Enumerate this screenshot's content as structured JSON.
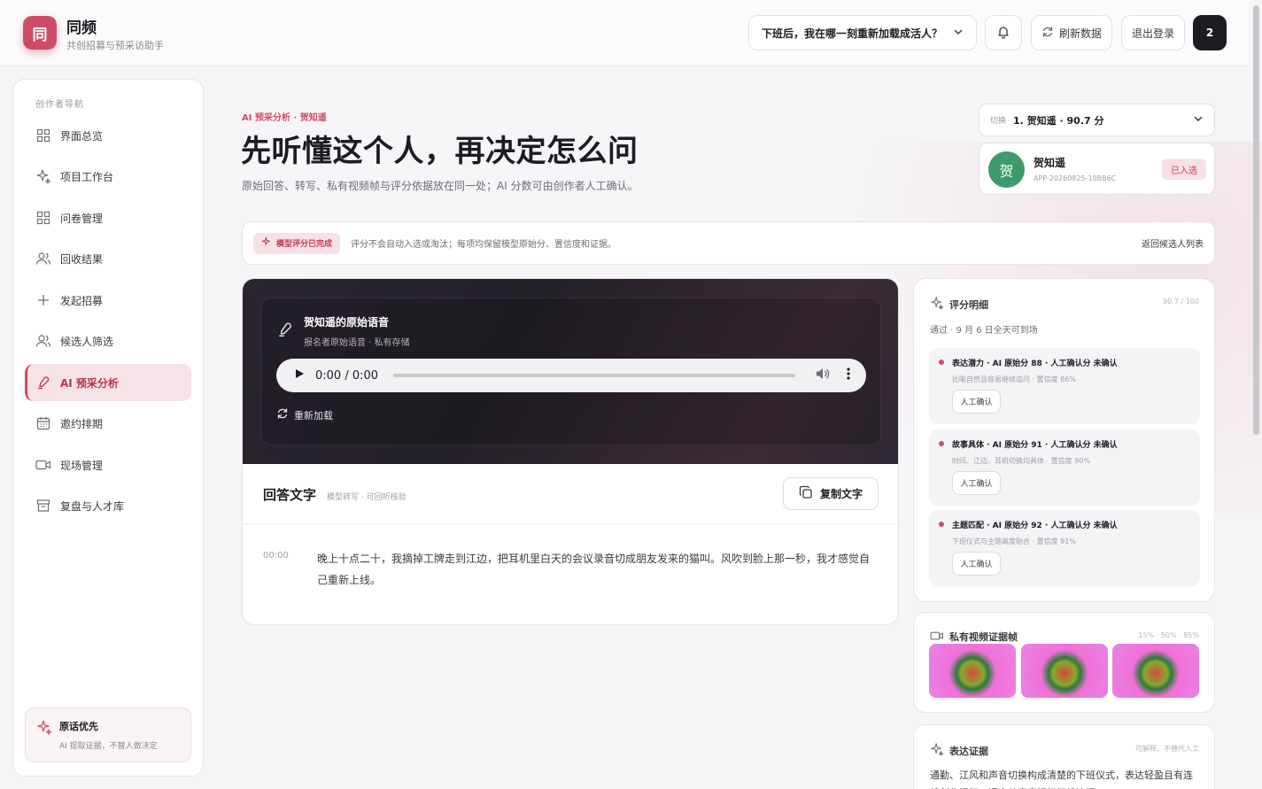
{
  "header": {
    "logo_char": "同",
    "brand": "同频",
    "subtitle": "共创招募与预采访助手",
    "session_select": "下班后，我在哪一刻重新加载成活人？",
    "refresh": "刷新数据",
    "logout": "退出登录",
    "count": "2"
  },
  "sidebar": {
    "title": "创作者导航",
    "items": [
      {
        "label": "界面总览",
        "icon": "grid-icon"
      },
      {
        "label": "项目工作台",
        "icon": "sparkle-icon"
      },
      {
        "label": "问卷管理",
        "icon": "grid-icon"
      },
      {
        "label": "回收结果",
        "icon": "users-icon"
      },
      {
        "label": "发起招募",
        "icon": "plus-icon"
      },
      {
        "label": "候选人筛选",
        "icon": "users-icon"
      },
      {
        "label": "AI 预采分析",
        "icon": "mic-icon"
      },
      {
        "label": "邀约排期",
        "icon": "calendar-icon"
      },
      {
        "label": "现场管理",
        "icon": "video-icon"
      },
      {
        "label": "复盘与人才库",
        "icon": "archive-icon"
      }
    ],
    "active_index": 6,
    "tip": {
      "title": "原话优先",
      "text": "AI 提取证据，不替人做决定"
    }
  },
  "page": {
    "kicker": "AI 预采分析 · 贺知遥",
    "title": "先听懂这个人，再决定怎么问",
    "desc": "原始回答、转写、私有视频帧与评分依据放在同一处；AI 分数可由创作者人工确认。"
  },
  "candidate": {
    "switch_label": "切换",
    "selected": "1. 贺知遥 · 90.7 分",
    "avatar_char": "贺",
    "name": "贺知遥",
    "id": "APP-20260825-10BB6C",
    "badge": "已入选"
  },
  "notice": {
    "tag": "模型评分已完成",
    "message": "评分不会自动入选或淘汰；每项均保留模型原始分、置信度和证据。",
    "back": "返回候选人列表"
  },
  "audio": {
    "title": "贺知遥的原始语音",
    "subtitle": "报名者原始语音 · 私有存储",
    "time": "0:00 / 0:00",
    "reload": "重新加载"
  },
  "answer": {
    "title": "回答文字",
    "subtitle": "模型转写 · 可回听核验",
    "copy": "复制文字",
    "segments": [
      {
        "time": "00:00",
        "text": "晚上十点二十，我摘掉工牌走到江边，把耳机里白天的会议录音切成朋友发来的猫叫。风吹到脸上那一秒，我才感觉自己重新上线。"
      }
    ]
  },
  "scores": {
    "title": "评分明细",
    "total": "90.7 / 100",
    "pass": "通过 · 9 月 6 日全天可到场",
    "items": [
      {
        "title": "表达潜力 · AI 原始分 88 · 人工确认分 未确认",
        "desc": "比喻自然且容易继续追问 · 置信度 86%",
        "confirm": "人工确认"
      },
      {
        "title": "故事具体 · AI 原始分 91 · 人工确认分 未确认",
        "desc": "时间、江边、耳机切换均具体 · 置信度 90%",
        "confirm": "人工确认"
      },
      {
        "title": "主题匹配 · AI 原始分 92 · 人工确认分 未确认",
        "desc": "下班仪式与主题高度贴合 · 置信度 91%",
        "confirm": "人工确认"
      }
    ]
  },
  "frames": {
    "title": "私有视频证据帧",
    "marks": "15% · 50% · 85%"
  },
  "evidence": {
    "title": "表达证据",
    "right": "可解释，不替代人工",
    "text": "通勤、江风和声音切换构成清楚的下班仪式，表达轻盈且有连续创作记忆，适合从声音记忆继续追问。"
  },
  "colors": {
    "accent": "#cf4c66",
    "accent_soft": "#f8e1e6",
    "dark": "#1e1b22"
  }
}
